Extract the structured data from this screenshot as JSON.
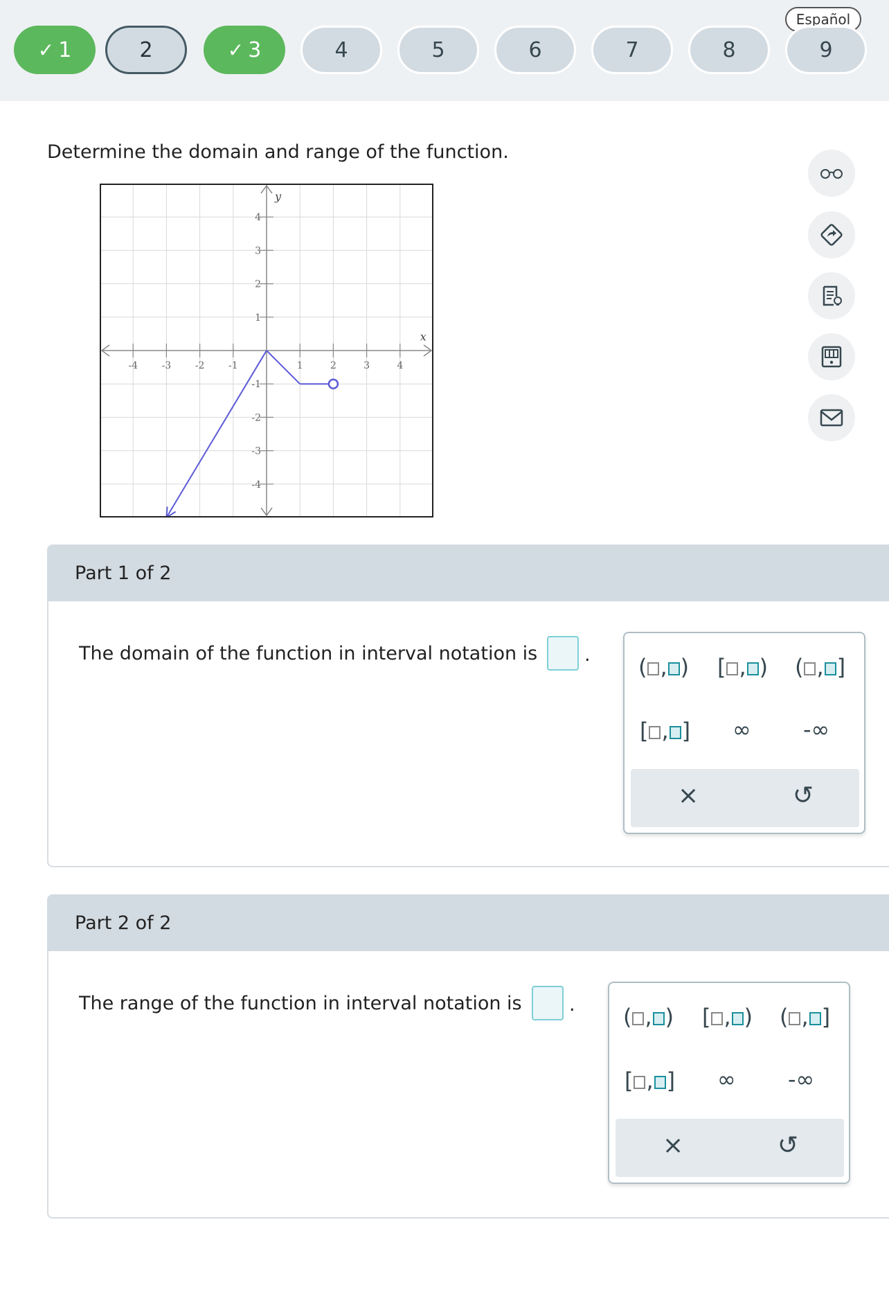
{
  "nav": {
    "language": "Español",
    "questions": [
      {
        "label": "1",
        "status": "done"
      },
      {
        "label": "2",
        "status": "current"
      },
      {
        "label": "3",
        "status": "done"
      },
      {
        "label": "4",
        "status": "todo"
      },
      {
        "label": "5",
        "status": "todo"
      },
      {
        "label": "6",
        "status": "todo"
      },
      {
        "label": "7",
        "status": "todo"
      },
      {
        "label": "8",
        "status": "todo"
      },
      {
        "label": "9",
        "status": "todo"
      }
    ],
    "check_glyph": "✓"
  },
  "prompt": "Determine the domain and range of the function.",
  "graph": {
    "x_label": "x",
    "y_label": "y",
    "x_ticks": [
      "-4",
      "-3",
      "-2",
      "-1",
      "1",
      "2",
      "3",
      "4"
    ],
    "y_ticks": [
      "4",
      "3",
      "2",
      "1",
      "-1",
      "-2",
      "-3",
      "-4"
    ],
    "range": [
      -5,
      5
    ],
    "curve_color": "#5b5bd6",
    "segments": [
      [
        [
          -3,
          -5
        ],
        [
          0,
          0
        ]
      ],
      [
        [
          0,
          0
        ],
        [
          1,
          -1
        ]
      ],
      [
        [
          1,
          -1
        ],
        [
          2,
          -1
        ]
      ]
    ],
    "open_endpoint": [
      2,
      -1
    ],
    "arrow_end": [
      -3,
      -5
    ]
  },
  "tools": [
    "glasses-icon",
    "hint-icon",
    "notes-icon",
    "calculator-icon",
    "mail-icon"
  ],
  "part1": {
    "header": "Part 1 of 2",
    "question": "The domain of the function in interval notation is",
    "period": "."
  },
  "part2": {
    "header": "Part 2 of 2",
    "question": "The range of the function in interval notation is",
    "period": "."
  },
  "palette": {
    "open_open": [
      "(",
      ",",
      ")"
    ],
    "closed_open": [
      "[",
      ",",
      ")"
    ],
    "open_closed": [
      "(",
      ",",
      "]"
    ],
    "closed_closed": [
      "[",
      ",",
      "]"
    ],
    "infinity": "∞",
    "neg_infinity": "-∞",
    "clear": "×",
    "undo": "↺"
  }
}
